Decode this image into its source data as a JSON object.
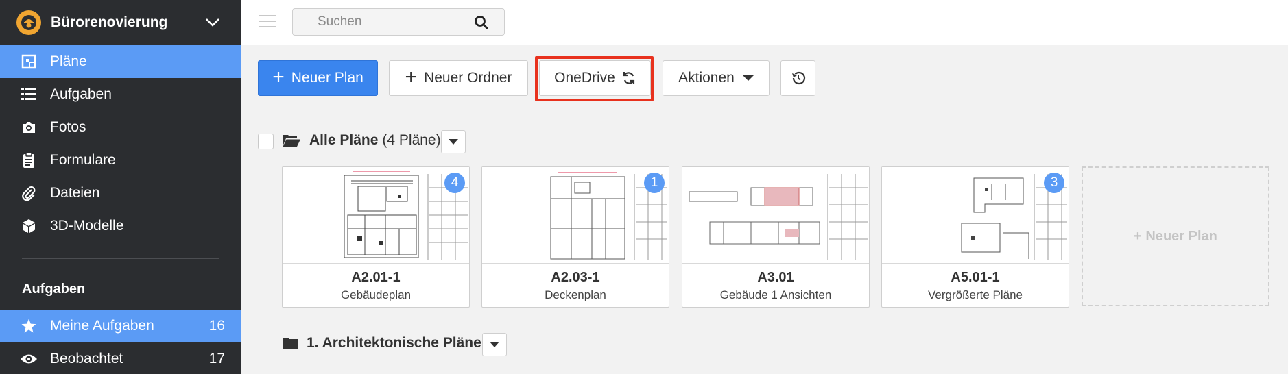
{
  "sidebar": {
    "project_name": "Bürorenovierung",
    "nav": [
      {
        "label": "Pläne",
        "icon": "plans-icon",
        "active": true
      },
      {
        "label": "Aufgaben",
        "icon": "list-icon"
      },
      {
        "label": "Fotos",
        "icon": "camera-icon"
      },
      {
        "label": "Formulare",
        "icon": "clipboard-icon"
      },
      {
        "label": "Dateien",
        "icon": "paperclip-icon"
      },
      {
        "label": "3D-Modelle",
        "icon": "cube-icon"
      }
    ],
    "section_title": "Aufgaben",
    "tasks": [
      {
        "label": "Meine Aufgaben",
        "count": "16",
        "icon": "star-icon",
        "active": true
      },
      {
        "label": "Beobachtet",
        "count": "17",
        "icon": "eye-icon"
      }
    ]
  },
  "topbar": {
    "search_placeholder": "Suchen"
  },
  "toolbar": {
    "new_plan": "Neuer Plan",
    "new_folder": "Neuer Ordner",
    "onedrive": "OneDrive",
    "actions": "Aktionen"
  },
  "all_plans": {
    "title": "Alle Pläne",
    "count_text": "(4 Pläne)"
  },
  "plans": [
    {
      "code": "A2.01-1",
      "name": "Gebäudeplan",
      "badge": "4"
    },
    {
      "code": "A2.03-1",
      "name": "Deckenplan",
      "badge": "1"
    },
    {
      "code": "A3.01",
      "name": "Gebäude 1 Ansichten",
      "badge": ""
    },
    {
      "code": "A5.01-1",
      "name": "Vergrößerte Pläne",
      "badge": "3"
    }
  ],
  "new_plan_card": "+ Neuer Plan",
  "folder": {
    "title": "1. Architektonische Pläne"
  },
  "colors": {
    "sidebar_bg": "#2b2d30",
    "active_nav": "#5b9bf5",
    "primary_button": "#3a85ee",
    "highlight_border": "#e8321e",
    "logo": "#f0a531"
  }
}
